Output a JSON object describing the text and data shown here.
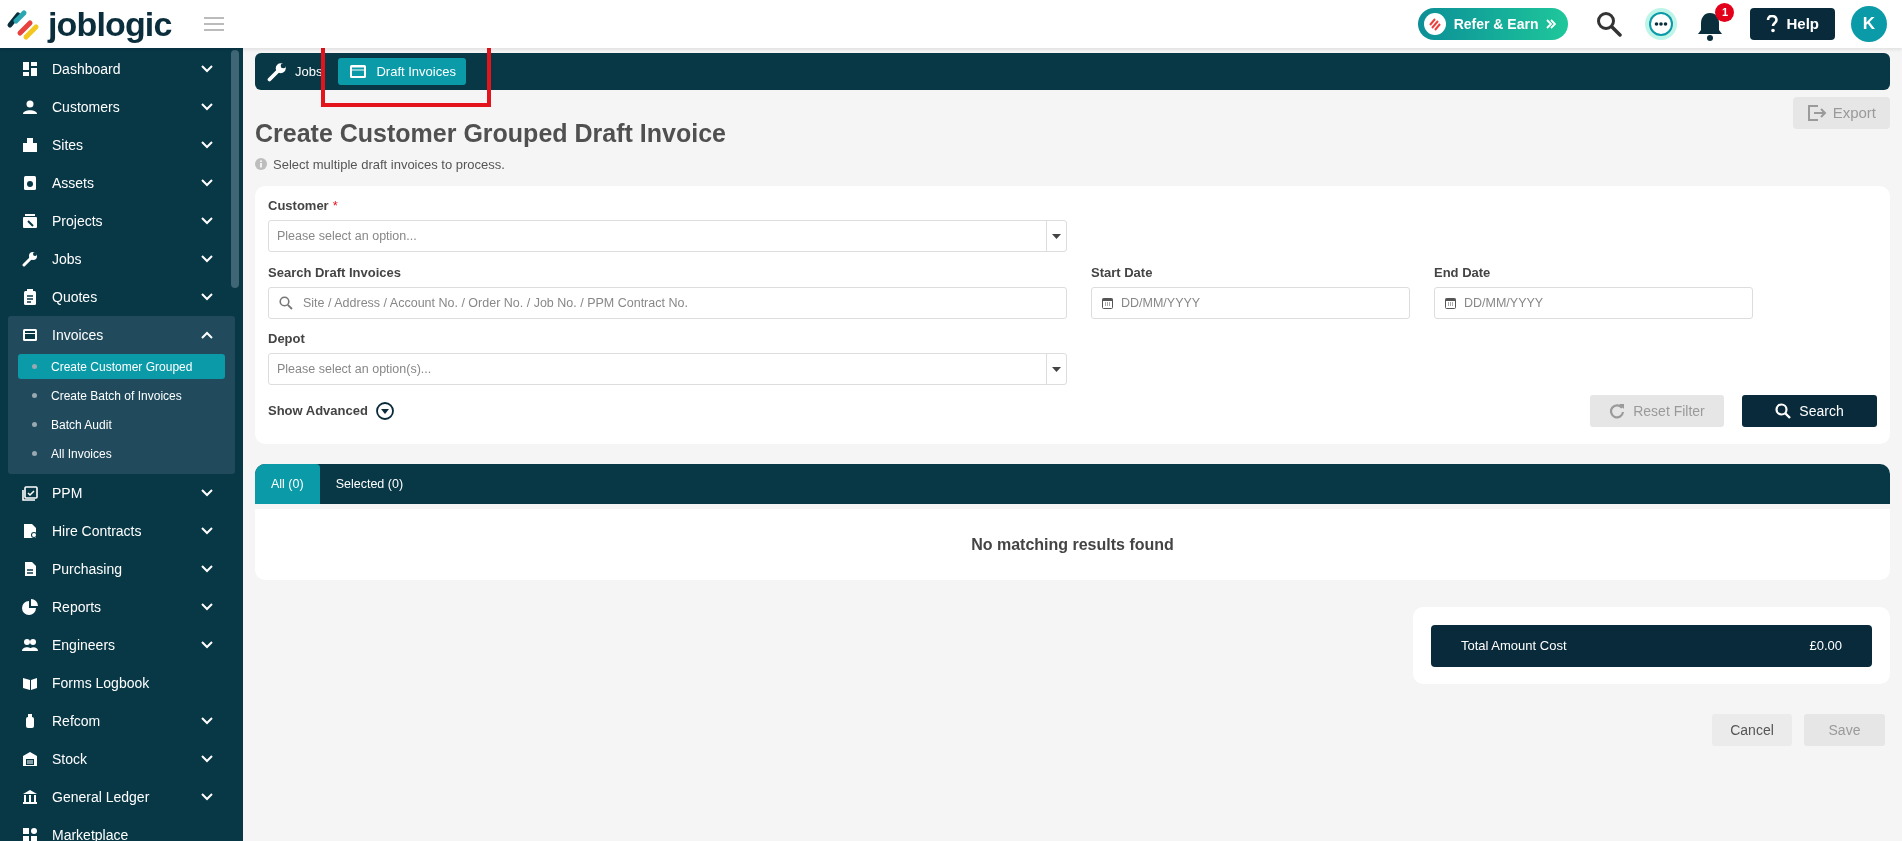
{
  "header": {
    "logo": "joblogic",
    "refer_button": "Refer & Earn",
    "notification_count": "1",
    "help_button": "Help",
    "avatar": "K"
  },
  "sidebar": {
    "items": [
      {
        "label": "Dashboard",
        "kind": "group",
        "expanded": false
      },
      {
        "label": "Customers",
        "kind": "group",
        "expanded": false
      },
      {
        "label": "Sites",
        "kind": "group",
        "expanded": false
      },
      {
        "label": "Assets",
        "kind": "group",
        "expanded": false
      },
      {
        "label": "Projects",
        "kind": "group",
        "expanded": false
      },
      {
        "label": "Jobs",
        "kind": "group",
        "expanded": false
      },
      {
        "label": "Quotes",
        "kind": "group",
        "expanded": false
      },
      {
        "label": "Invoices",
        "kind": "group",
        "expanded": true,
        "children": [
          {
            "label": "Create Customer Grouped",
            "selected": true
          },
          {
            "label": "Create Batch of Invoices",
            "selected": false
          },
          {
            "label": "Batch Audit",
            "selected": false
          },
          {
            "label": "All Invoices",
            "selected": false
          }
        ]
      },
      {
        "label": "PPM",
        "kind": "group",
        "expanded": false
      },
      {
        "label": "Hire Contracts",
        "kind": "group",
        "expanded": false
      },
      {
        "label": "Purchasing",
        "kind": "group",
        "expanded": false
      },
      {
        "label": "Reports",
        "kind": "group",
        "expanded": false
      },
      {
        "label": "Engineers",
        "kind": "group",
        "expanded": false
      },
      {
        "label": "Forms Logbook",
        "kind": "link"
      },
      {
        "label": "Refcom",
        "kind": "group",
        "expanded": false
      },
      {
        "label": "Stock",
        "kind": "group",
        "expanded": false
      },
      {
        "label": "General Ledger",
        "kind": "group",
        "expanded": false
      },
      {
        "label": "Marketplace",
        "kind": "link"
      }
    ]
  },
  "breadcrumb": [
    {
      "label": "Jobs",
      "selected": false
    },
    {
      "label": "Draft Invoices",
      "selected": true
    }
  ],
  "page": {
    "title": "Create Customer Grouped Draft Invoice",
    "info": "Select multiple draft invoices to process.",
    "export_button": {
      "label": "Export",
      "disabled": true
    }
  },
  "filters": {
    "customer": {
      "label": "Customer",
      "required": true,
      "required_mark": "*",
      "placeholder": "Please select an option..."
    },
    "search": {
      "label": "Search Draft Invoices",
      "placeholder": "Site / Address / Account No. / Order No. / Job No. / PPM Contract No."
    },
    "start_date": {
      "label": "Start Date",
      "placeholder": "DD/MM/YYYY"
    },
    "end_date": {
      "label": "End Date",
      "placeholder": "DD/MM/YYYY"
    },
    "depot": {
      "label": "Depot",
      "placeholder": "Please select an option(s)..."
    },
    "show_advanced": "Show Advanced",
    "reset_button": {
      "label": "Reset Filter",
      "disabled": true
    },
    "search_button": {
      "label": "Search",
      "disabled": false
    }
  },
  "tabs": [
    {
      "label": "All (0)",
      "selected": true
    },
    {
      "label": "Selected (0)",
      "selected": false
    }
  ],
  "results": {
    "empty_message": "No matching results found"
  },
  "total": {
    "label": "Total Amount Cost",
    "value": "£0.00"
  },
  "actions": {
    "cancel_button": {
      "label": "Cancel",
      "disabled": false
    },
    "save_button": {
      "label": "Save",
      "disabled": true
    }
  }
}
